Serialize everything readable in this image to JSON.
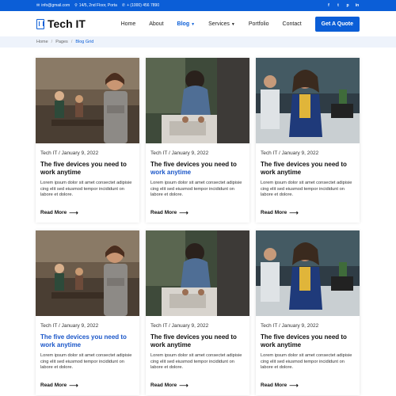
{
  "topbar": {
    "email": "info@gmail.com",
    "address": "14/5, 2nd Floor, Porta",
    "phone": "+ (1000) 456 7890",
    "social": [
      "facebook-icon",
      "twitter-icon",
      "pinterest-icon",
      "linkedin-icon"
    ]
  },
  "navbar": {
    "brand": "Tech IT",
    "items": {
      "home": "Home",
      "about": "About",
      "blog": "Blog",
      "services": "Services",
      "portfolio": "Portfolio",
      "contact": "Contact"
    },
    "cta": "Get A Quote"
  },
  "breadcrumb": {
    "home": "Home",
    "pages": "Pages",
    "current": "Blog Grid"
  },
  "posts": [
    {
      "meta": "Tech IT / January 9, 2022",
      "title_a": "The five devices you need to",
      "title_b": "work anytime",
      "excerpt": "Lorem ipsum dolor sit amet consectet adipisie cing elit sed eiusmod tempor incididunt on labore et dolore.",
      "read_more": "Read More"
    },
    {
      "meta": "Tech IT / January 9, 2022",
      "title_a": "The five devices you need to",
      "title_b": "work anytime",
      "excerpt": "Lorem ipsum dolor sit amet consectet adipisie cing elit sed eiusmod tempor incididunt on labore et dolore.",
      "read_more": "Read More"
    },
    {
      "meta": "Tech IT / January 9, 2022",
      "title_a": "The five devices you need to",
      "title_b": "work anytime",
      "excerpt": "Lorem ipsum dolor sit amet consectet adipisie cing elit sed eiusmod tempor incididunt on labore et dolore.",
      "read_more": "Read More"
    },
    {
      "meta": "Tech IT / January 9, 2022",
      "title_a": "The five devices you need to",
      "title_b": "work anytime",
      "excerpt": "Lorem ipsum dolor sit amet consectet adipisie cing elit sed eiusmod tempor incididunt on labore et dolore.",
      "read_more": "Read More"
    },
    {
      "meta": "Tech IT / January 9, 2022",
      "title_a": "The five devices you need to",
      "title_b": "work anytime",
      "excerpt": "Lorem ipsum dolor sit amet consectet adipisie cing elit sed eiusmod tempor incididunt on labore et dolore.",
      "read_more": "Read More"
    },
    {
      "meta": "Tech IT / January 9, 2022",
      "title_a": "The five devices you need to",
      "title_b": "work anytime",
      "excerpt": "Lorem ipsum dolor sit amet consectet adipisie cing elit sed eiusmod tempor incididunt on labore et dolore.",
      "read_more": "Read More"
    }
  ],
  "colors": {
    "primary": "#0b5ed7",
    "link_hover": "#1a56c8",
    "breadcrumb_bg": "#eef3fb"
  }
}
